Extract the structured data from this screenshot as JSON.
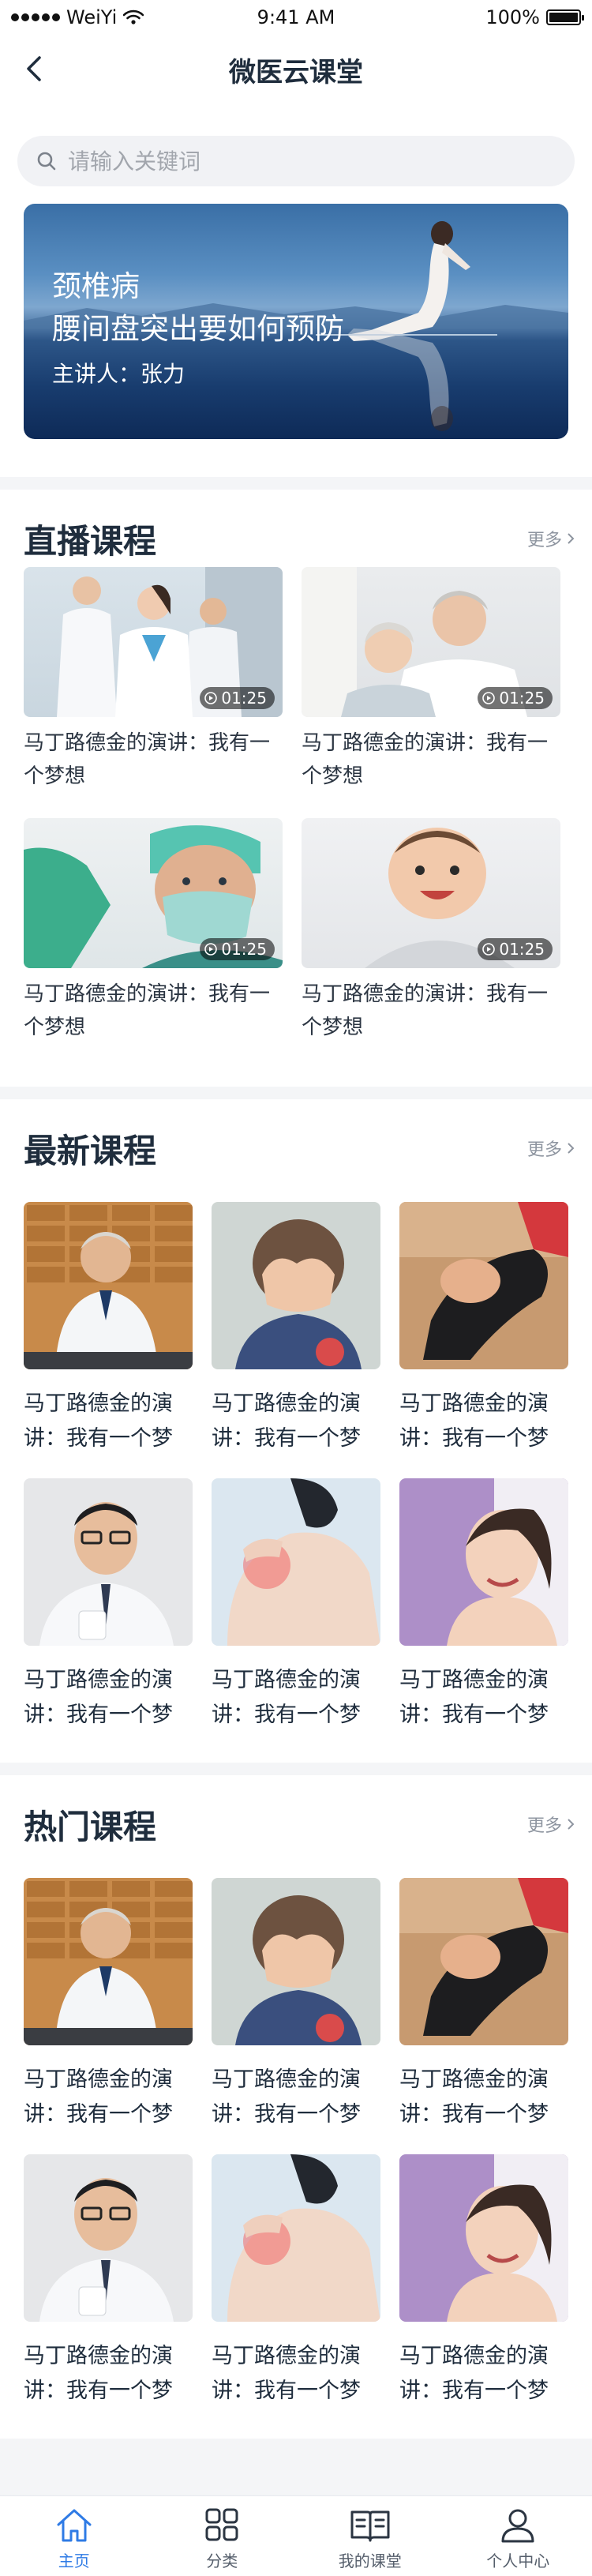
{
  "status_bar": {
    "carrier": "WeiYi",
    "time": "9:41 AM",
    "battery": "100%",
    "battery_level": 1.0
  },
  "nav": {
    "title": "微医云课堂"
  },
  "search": {
    "placeholder": "请输入关键词"
  },
  "banner": {
    "title_line1": "颈椎病",
    "title_line2": "腰间盘突出要如何预防",
    "speaker": "主讲人：张力"
  },
  "live": {
    "title": "直播课程",
    "more": "更多",
    "items": [
      {
        "title": "马丁路德金的演讲：我有一个梦想",
        "duration": "01:25"
      },
      {
        "title": "马丁路德金的演讲：我有一个梦想",
        "duration": "01:25"
      },
      {
        "title": "马丁路德金的演讲：我有一个梦想",
        "duration": "01:25"
      },
      {
        "title": "马丁路德金的演讲：我有一个梦想",
        "duration": "01:25"
      }
    ]
  },
  "latest": {
    "title": "最新课程",
    "more": "更多",
    "items": [
      {
        "line1": "马丁路德金的演",
        "line2": "讲：我有一个梦"
      },
      {
        "line1": "马丁路德金的演",
        "line2": "讲：我有一个梦"
      },
      {
        "line1": "马丁路德金的演",
        "line2": "讲：我有一个梦"
      },
      {
        "line1": "马丁路德金的演",
        "line2": "讲：我有一个梦"
      },
      {
        "line1": "马丁路德金的演",
        "line2": "讲：我有一个梦"
      },
      {
        "line1": "马丁路德金的演",
        "line2": "讲：我有一个梦"
      }
    ]
  },
  "hot": {
    "title": "热门课程",
    "more": "更多",
    "items": [
      {
        "line1": "马丁路德金的演",
        "line2": "讲：我有一个梦"
      },
      {
        "line1": "马丁路德金的演",
        "line2": "讲：我有一个梦"
      },
      {
        "line1": "马丁路德金的演",
        "line2": "讲：我有一个梦"
      },
      {
        "line1": "马丁路德金的演",
        "line2": "讲：我有一个梦"
      },
      {
        "line1": "马丁路德金的演",
        "line2": "讲：我有一个梦"
      },
      {
        "line1": "马丁路德金的演",
        "line2": "讲：我有一个梦"
      }
    ]
  },
  "tabs": [
    {
      "label": "主页",
      "icon": "home-icon",
      "active": true
    },
    {
      "label": "分类",
      "icon": "category-grid-icon",
      "active": false
    },
    {
      "label": "我的课堂",
      "icon": "open-book-icon",
      "active": false
    },
    {
      "label": "个人中心",
      "icon": "user-icon",
      "active": false
    }
  ],
  "colors": {
    "accent": "#2f7be5",
    "text": "#1f2d3d",
    "muted": "#8e95a0",
    "background": "#f4f5f7"
  }
}
